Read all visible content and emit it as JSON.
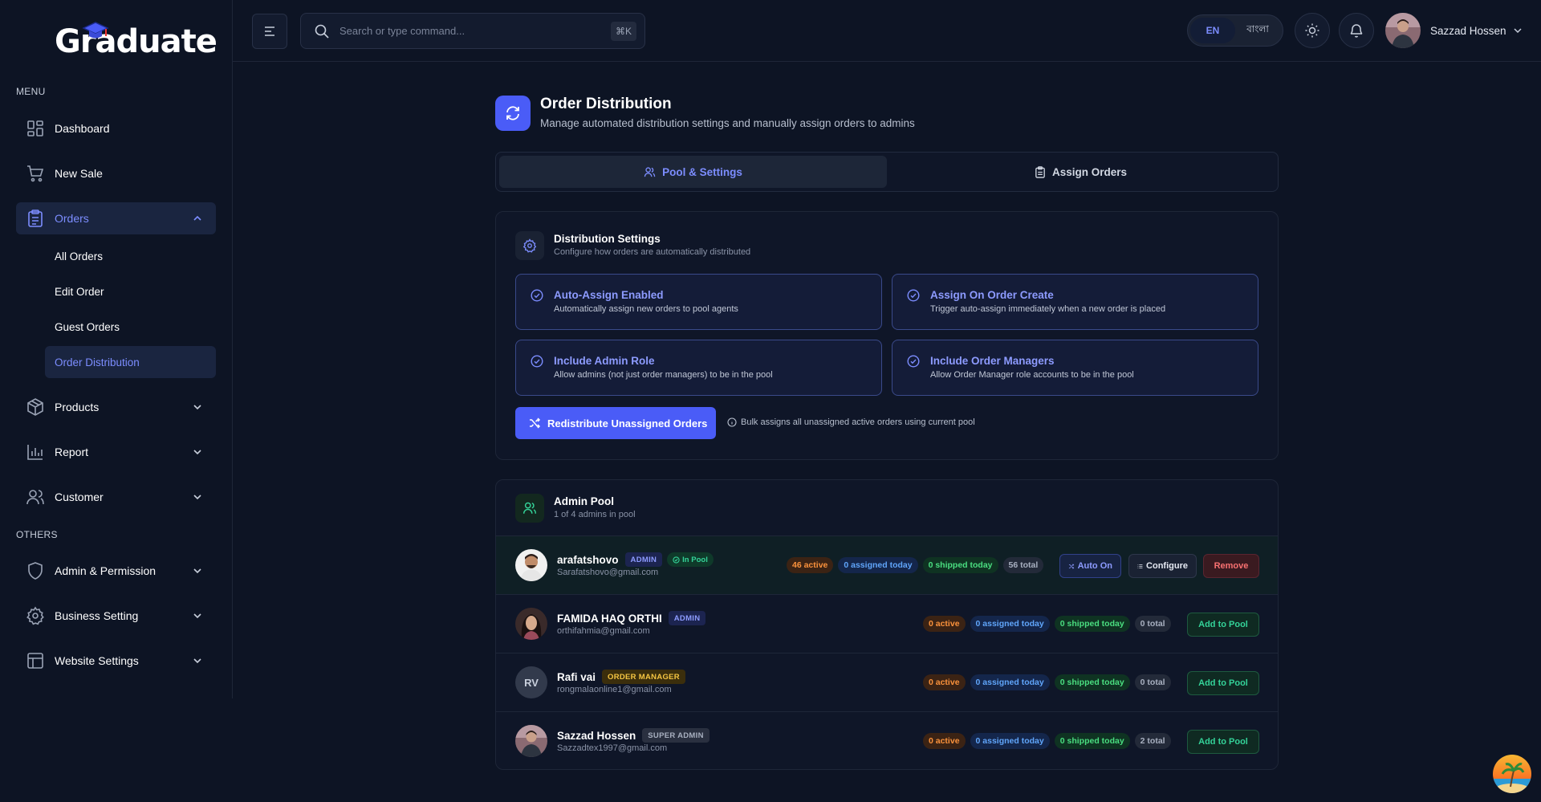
{
  "app": {
    "logo_text": "Graduate"
  },
  "sidebar": {
    "menu_label": "MENU",
    "others_label": "OTHERS",
    "items": [
      {
        "label": "Dashboard",
        "icon": "grid-icon"
      },
      {
        "label": "New Sale",
        "icon": "cart-icon"
      },
      {
        "label": "Orders",
        "icon": "clipboard-icon"
      },
      {
        "label": "Products",
        "icon": "box-icon"
      },
      {
        "label": "Report",
        "icon": "bar-chart-icon"
      },
      {
        "label": "Customer",
        "icon": "users-icon"
      },
      {
        "label": "Admin & Permission",
        "icon": "shield-icon"
      },
      {
        "label": "Business Setting",
        "icon": "gear-icon"
      },
      {
        "label": "Website Settings",
        "icon": "layout-icon"
      }
    ],
    "orders_sub": [
      "All Orders",
      "Edit Order",
      "Guest Orders",
      "Order Distribution"
    ]
  },
  "header": {
    "search_placeholder": "Search or type command...",
    "shortcut": "⌘K",
    "lang_en": "EN",
    "lang_bn": "বাংলা",
    "user_name": "Sazzad Hossen"
  },
  "page": {
    "title": "Order Distribution",
    "subtitle": "Manage automated distribution settings and manually assign orders to admins",
    "tabs": [
      "Pool & Settings",
      "Assign Orders"
    ]
  },
  "settings": {
    "title": "Distribution Settings",
    "subtitle": "Configure how orders are automatically distributed",
    "options": [
      {
        "title": "Auto-Assign Enabled",
        "desc": "Automatically assign new orders to pool agents"
      },
      {
        "title": "Assign On Order Create",
        "desc": "Trigger auto-assign immediately when a new order is placed"
      },
      {
        "title": "Include Admin Role",
        "desc": "Allow admins (not just order managers) to be in the pool"
      },
      {
        "title": "Include Order Managers",
        "desc": "Allow Order Manager role accounts to be in the pool"
      }
    ],
    "redistribute_label": "Redistribute Unassigned Orders",
    "redistribute_note": "Bulk assigns all unassigned active orders using current pool"
  },
  "pool": {
    "title": "Admin Pool",
    "subtitle": "1 of 4 admins in pool",
    "in_pool_label": "In Pool",
    "auto_on_label": "Auto On",
    "configure_label": "Configure",
    "remove_label": "Remove",
    "add_label": "Add to Pool",
    "members": [
      {
        "name": "arafatshovo",
        "role": "ADMIN",
        "email": "Sarafatshovo@gmail.com",
        "active": "46 active",
        "assigned": "0 assigned today",
        "shipped": "0 shipped today",
        "total": "56 total",
        "in_pool": true
      },
      {
        "name": "FAMIDA HAQ ORTHI",
        "role": "ADMIN",
        "email": "orthifahmia@gmail.com",
        "active": "0 active",
        "assigned": "0 assigned today",
        "shipped": "0 shipped today",
        "total": "0 total",
        "in_pool": false
      },
      {
        "name": "Rafi vai",
        "role": "ORDER MANAGER",
        "initials": "RV",
        "email": "rongmalaonline1@gmail.com",
        "active": "0 active",
        "assigned": "0 assigned today",
        "shipped": "0 shipped today",
        "total": "0 total",
        "in_pool": false
      },
      {
        "name": "Sazzad Hossen",
        "role": "SUPER ADMIN",
        "email": "Sazzadtex1997@gmail.com",
        "active": "0 active",
        "assigned": "0 assigned today",
        "shipped": "0 shipped today",
        "total": "2 total",
        "in_pool": false
      }
    ]
  },
  "colors": {
    "accent": "#4a5cf7",
    "accent_text": "#7c8dff",
    "background": "#0d1424",
    "success": "#34d399",
    "danger": "#f87171"
  }
}
